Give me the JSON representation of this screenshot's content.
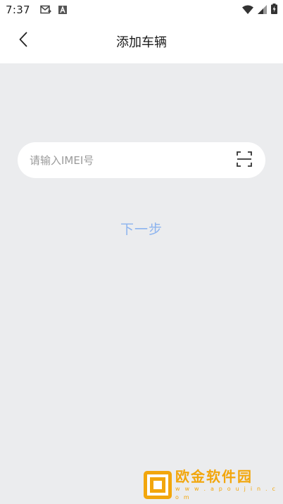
{
  "status_bar": {
    "time": "7:37",
    "icons": [
      "gmail-icon",
      "font-a-icon",
      "wifi-icon",
      "signal-icon",
      "battery-icon"
    ]
  },
  "header": {
    "back_icon": "chevron-left-icon",
    "title": "添加车辆"
  },
  "form": {
    "imei_placeholder": "请输入IMEI号",
    "imei_value": "",
    "scan_icon": "scan-icon",
    "next_label": "下一步"
  },
  "watermark": {
    "text": "欧金软件园",
    "url": "w w w . a p o u j i n . c o m"
  },
  "colors": {
    "background": "#ebecee",
    "next_button": "#8cb3ef",
    "watermark": "#f2a60c"
  }
}
